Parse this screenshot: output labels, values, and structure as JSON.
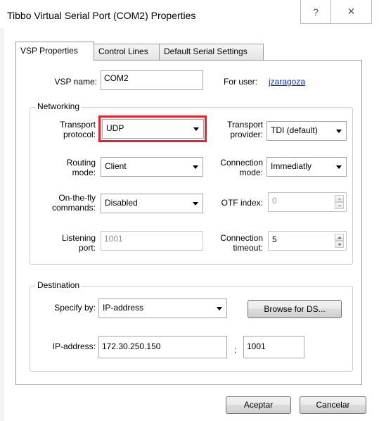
{
  "window": {
    "title": "Tibbo Virtual Serial Port (COM2) Properties",
    "help_button": "?",
    "close_button": "×"
  },
  "tabs": [
    {
      "label": "VSP Properties",
      "active": true
    },
    {
      "label": "Control Lines",
      "active": false
    },
    {
      "label": "Default Serial Settings",
      "active": false
    }
  ],
  "vsp": {
    "name_label": "VSP name:",
    "name_value": "COM2",
    "for_user_label": "For user:",
    "for_user_value": "jzaragoza"
  },
  "networking": {
    "group_title": "Networking",
    "transport_protocol_label_1": "Transport",
    "transport_protocol_label_2": "protocol:",
    "transport_protocol_value": "UDP",
    "transport_provider_label_1": "Transport",
    "transport_provider_label_2": "provider:",
    "transport_provider_value": "TDI (default)",
    "routing_mode_label_1": "Routing",
    "routing_mode_label_2": "mode:",
    "routing_mode_value": "Client",
    "connection_mode_label_1": "Connection",
    "connection_mode_label_2": "mode:",
    "connection_mode_value": "Immediatly",
    "onthefly_label_1": "On-the-fly",
    "onthefly_label_2": "commands:",
    "onthefly_value": "Disabled",
    "otf_index_label": "OTF index:",
    "otf_index_value": "0",
    "listening_port_label_1": "Listening",
    "listening_port_label_2": "port:",
    "listening_port_value": "1001",
    "connection_timeout_label_1": "Connection",
    "connection_timeout_label_2": "timeout:",
    "connection_timeout_value": "5"
  },
  "destination": {
    "group_title": "Destination",
    "specify_by_label": "Specify by:",
    "specify_by_value": "IP-address",
    "browse_button": "Browse for DS...",
    "ip_label": "IP-address:",
    "ip_value": "172.30.250.150",
    "port_separator": ":",
    "port_value": "1001"
  },
  "footer": {
    "ok_button": "Aceptar",
    "cancel_button": "Cancelar"
  },
  "colors": {
    "highlight": "#e8222b",
    "link": "#0033cc"
  }
}
